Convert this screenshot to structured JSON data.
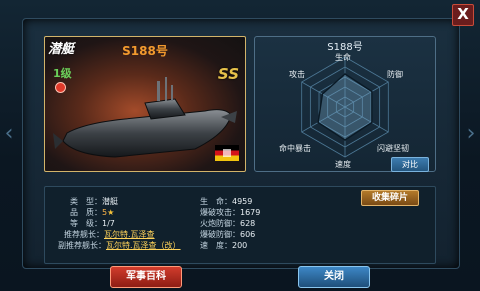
{
  "window": {
    "close_label": "X"
  },
  "nav": {
    "left_arrow": "‹",
    "right_arrow": "›"
  },
  "ship": {
    "type_badge": "潜艇",
    "name": "S188号",
    "level": "1级",
    "rank": "SS"
  },
  "radar": {
    "title": "S188号",
    "axes": [
      "生命",
      "防御",
      "闪避坚韧",
      "速度",
      "命中暴击",
      "攻击"
    ],
    "values": [
      0.66,
      0.62,
      0.62,
      0.66,
      0.62,
      0.52
    ],
    "compare_label": "对比"
  },
  "info": {
    "left": [
      {
        "label": "类　型：",
        "value": "潜艇"
      },
      {
        "label": "品　质：",
        "value": "5"
      },
      {
        "label": "等　级：",
        "value": "1/7"
      },
      {
        "label": "推荐舰长：",
        "value": "瓦尔特.瓦泽查"
      },
      {
        "label": "副推荐舰长：",
        "value": "瓦尔特.瓦泽查（改）"
      }
    ],
    "right": [
      {
        "label": "生　命",
        "value": "4959"
      },
      {
        "label": "爆破攻击",
        "value": "1679"
      },
      {
        "label": "火炮防御",
        "value": "628"
      },
      {
        "label": "爆破防御",
        "value": "606"
      },
      {
        "label": "速　度",
        "value": "200"
      }
    ],
    "collect_label": "收集碎片"
  },
  "buttons": {
    "encyclopedia": "军事百科",
    "close": "关闭"
  }
}
